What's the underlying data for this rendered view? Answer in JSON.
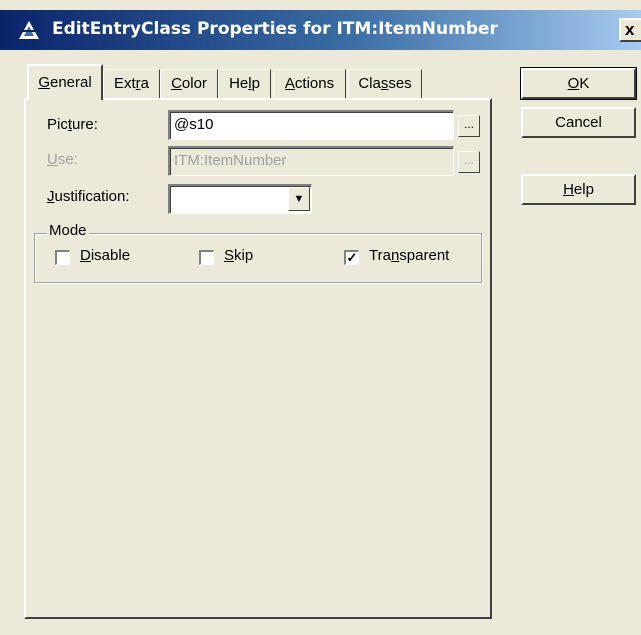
{
  "window": {
    "title": "EditEntryClass Properties for ITM:ItemNumber",
    "icon": "clarion-triangle-icon",
    "close_glyph": "x"
  },
  "tabs": [
    {
      "pre": "",
      "key": "G",
      "post": "eneral",
      "active": true
    },
    {
      "pre": "Ext",
      "key": "r",
      "post": "a",
      "active": false
    },
    {
      "pre": "",
      "key": "C",
      "post": "olor",
      "active": false
    },
    {
      "pre": "He",
      "key": "l",
      "post": "p",
      "active": false
    },
    {
      "pre": "",
      "key": "A",
      "post": "ctions",
      "active": false
    },
    {
      "pre": "Cla",
      "key": "s",
      "post": "ses",
      "active": false
    }
  ],
  "general": {
    "picture": {
      "pre": "Pic",
      "key": "t",
      "post": "ure:",
      "value": "@s10",
      "ellipsis": "..."
    },
    "use": {
      "pre": "",
      "key": "U",
      "post": "se:",
      "value": "ITM:ItemNumber",
      "ellipsis": "..."
    },
    "justification": {
      "pre": "",
      "key": "J",
      "post": "ustification:",
      "value": "",
      "arrow": "▼"
    },
    "mode": {
      "label": "Mode",
      "disable": {
        "pre": "",
        "key": "D",
        "post": "isable",
        "checked": false
      },
      "skip": {
        "pre": "",
        "key": "S",
        "post": "kip",
        "checked": false
      },
      "transparent": {
        "pre": "Tra",
        "key": "n",
        "post": "sparent",
        "checked": true,
        "mark": "✓"
      }
    }
  },
  "buttons": {
    "ok": {
      "pre": "",
      "key": "O",
      "post": "K"
    },
    "cancel": {
      "label": "Cancel"
    },
    "help": {
      "pre": "",
      "key": "H",
      "post": "elp"
    }
  }
}
